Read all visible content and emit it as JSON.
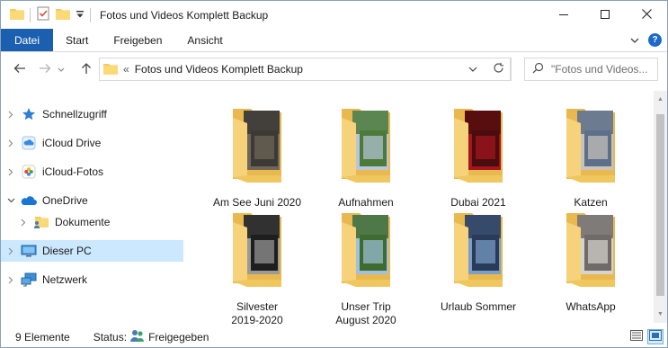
{
  "window": {
    "title": "Fotos und Videos Komplett Backup",
    "accent": "#1b5fb0"
  },
  "quick_access_toolbar": {
    "icons": [
      "folder-icon",
      "properties-checkmark-icon",
      "new-folder-icon",
      "customize-dropdown-icon"
    ]
  },
  "window_controls": {
    "icons": [
      "minimize-icon",
      "maximize-icon",
      "close-icon"
    ]
  },
  "ribbon": {
    "tabs": [
      {
        "label": "Datei",
        "active": true
      },
      {
        "label": "Start"
      },
      {
        "label": "Freigeben"
      },
      {
        "label": "Ansicht"
      }
    ],
    "help_label": "?"
  },
  "address": {
    "overflow": "«",
    "path": "Fotos und Videos Komplett Backup"
  },
  "search": {
    "placeholder": "\"Fotos und Videos..."
  },
  "nav_pane": {
    "items": [
      {
        "label": "Schnellzugriff",
        "icon": "star-icon",
        "expanded": false
      },
      {
        "label": "iCloud Drive",
        "icon": "icloud-icon",
        "expanded": false
      },
      {
        "label": "iCloud-Fotos",
        "icon": "icloud-photos-icon",
        "expanded": false
      },
      {
        "label": "OneDrive",
        "icon": "onedrive-icon",
        "expanded": true
      },
      {
        "label": "Dokumente",
        "icon": "shared-folder-icon",
        "expanded": false
      },
      {
        "label": "Dieser PC",
        "icon": "computer-icon",
        "expanded": false,
        "selected": true
      },
      {
        "label": "Netzwerk",
        "icon": "network-icon",
        "expanded": false
      }
    ]
  },
  "folders": [
    {
      "name": "Am See Juni 2020",
      "thumb": [
        "#3c3a36",
        "#6f6759"
      ]
    },
    {
      "name": "Aufnahmen",
      "thumb": [
        "#4c7a3a",
        "#b7c6d8"
      ]
    },
    {
      "name": "Dubai 2021",
      "thumb": [
        "#4a0d0d",
        "#a5151f"
      ]
    },
    {
      "name": "Katzen",
      "thumb": [
        "#5d6f8a",
        "#c9c3b9"
      ]
    },
    {
      "name": "Silvester\n2019-2020",
      "lines": [
        "Silvester",
        "2019-2020"
      ],
      "thumb": [
        "#1e1e1e",
        "#9a9a9a"
      ]
    },
    {
      "name": "Unser Trip\nAugust 2020",
      "lines": [
        "Unser Trip",
        "August 2020"
      ],
      "thumb": [
        "#3f6b2e",
        "#9fc1de"
      ]
    },
    {
      "name": "Urlaub Sommer",
      "thumb": [
        "#2a3b5a",
        "#7aa0c8"
      ]
    },
    {
      "name": "WhatsApp",
      "thumb": [
        "#6e6b68",
        "#d7d3cf"
      ]
    }
  ],
  "statusbar": {
    "count": "9 Elemente",
    "status_label": "Status:",
    "status_value": "Freigegeben"
  }
}
